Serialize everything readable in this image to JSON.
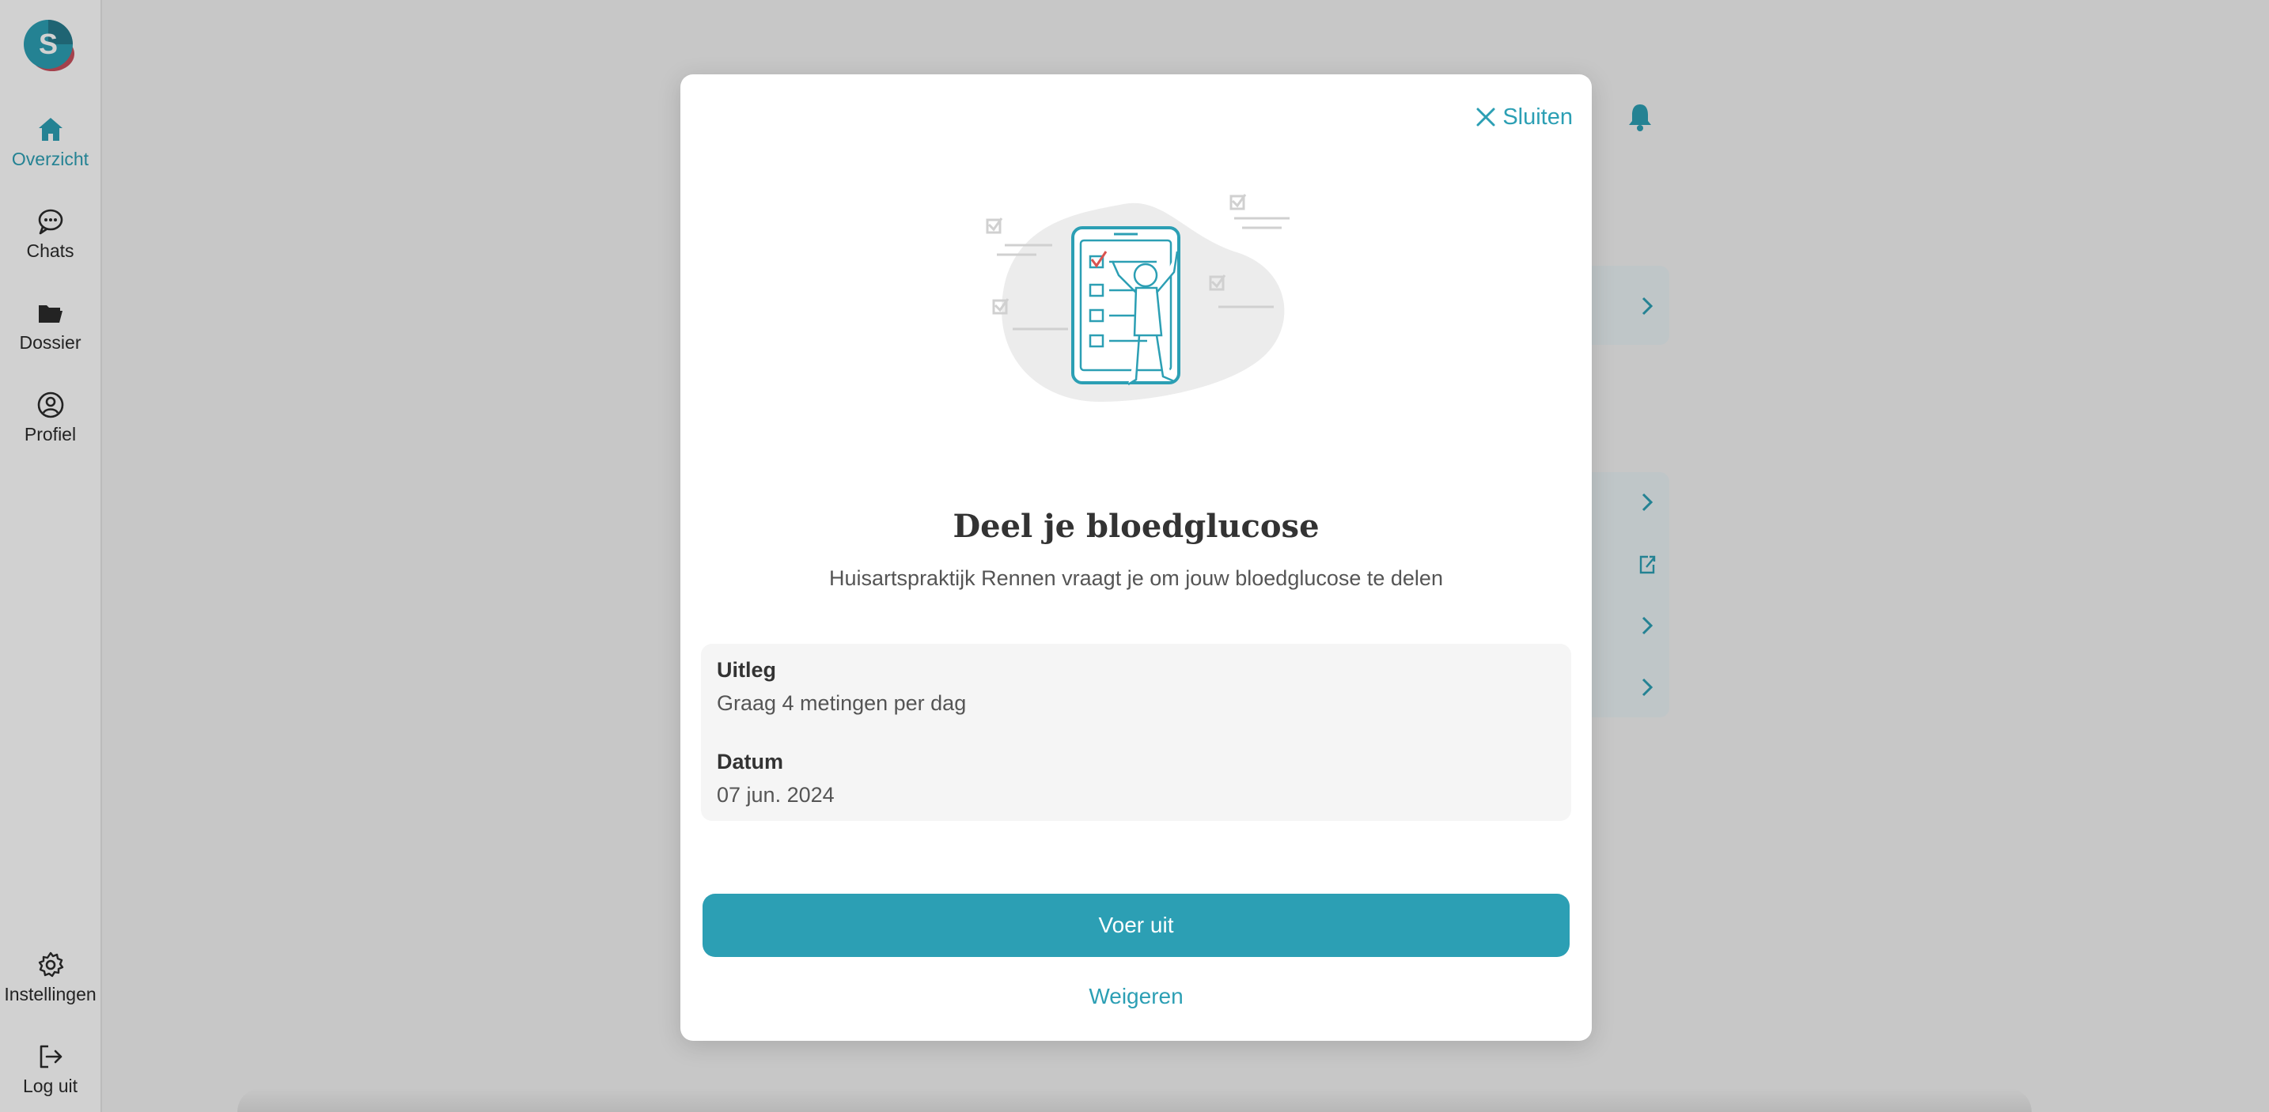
{
  "sidebar": {
    "logo_letter": "S",
    "items": [
      {
        "label": "Overzicht",
        "icon": "home-icon",
        "active": true
      },
      {
        "label": "Chats",
        "icon": "chat-bubble-icon"
      },
      {
        "label": "Dossier",
        "icon": "folder-icon"
      },
      {
        "label": "Profiel",
        "icon": "user-circle-icon"
      }
    ],
    "bottom_items": [
      {
        "label": "Instellingen",
        "icon": "gear-icon"
      },
      {
        "label": "Log uit",
        "icon": "logout-icon"
      }
    ]
  },
  "modal": {
    "close_label": "Sluiten",
    "title": "Deel je bloedglucose",
    "subtitle": "Huisartspraktijk Rennen vraagt je om jouw bloedglucose te delen",
    "details": [
      {
        "label": "Uitleg",
        "value": "Graag 4 metingen per dag"
      },
      {
        "label": "Datum",
        "value": "07 jun. 2024"
      }
    ],
    "primary_action": "Voer uit",
    "secondary_action": "Weigeren"
  },
  "colors": {
    "accent": "#2c9fb4",
    "overlay": "rgba(0,0,0,0.18)",
    "logo_red": "#c9505d",
    "logo_teal": "#2c9fb4"
  }
}
